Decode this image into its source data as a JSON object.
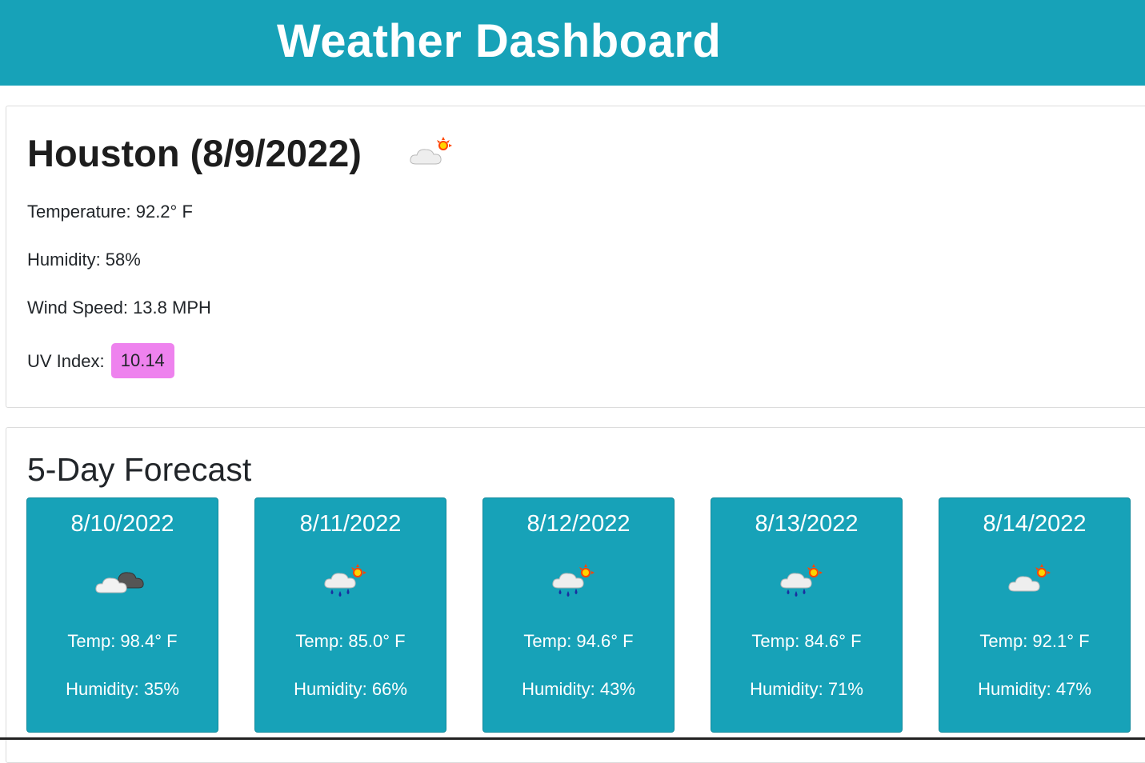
{
  "header": {
    "title": "Weather Dashboard"
  },
  "current": {
    "title": "Houston (8/9/2022)",
    "icon": "partly-cloudy-sun-icon",
    "temperature_label": "Temperature: 92.2° F",
    "humidity_label": "Humidity: 58%",
    "wind_label": "Wind Speed: 13.8 MPH",
    "uv_label": "UV Index:",
    "uv_value": "10.14",
    "uv_color": "#ee82ee"
  },
  "forecast": {
    "title": "5-Day Forecast",
    "days": [
      {
        "date": "8/10/2022",
        "icon": "cloudy-icon",
        "temp": "Temp: 98.4° F",
        "humidity": "Humidity: 35%"
      },
      {
        "date": "8/11/2022",
        "icon": "rain-sun-icon",
        "temp": "Temp: 85.0° F",
        "humidity": "Humidity: 66%"
      },
      {
        "date": "8/12/2022",
        "icon": "rain-sun-icon",
        "temp": "Temp: 94.6° F",
        "humidity": "Humidity: 43%"
      },
      {
        "date": "8/13/2022",
        "icon": "rain-sun-icon",
        "temp": "Temp: 84.6° F",
        "humidity": "Humidity: 71%"
      },
      {
        "date": "8/14/2022",
        "icon": "partly-cloudy-sun-icon",
        "temp": "Temp: 92.1° F",
        "humidity": "Humidity: 47%"
      }
    ]
  },
  "colors": {
    "accent": "#17a2b8",
    "uv": "#ee82ee"
  }
}
